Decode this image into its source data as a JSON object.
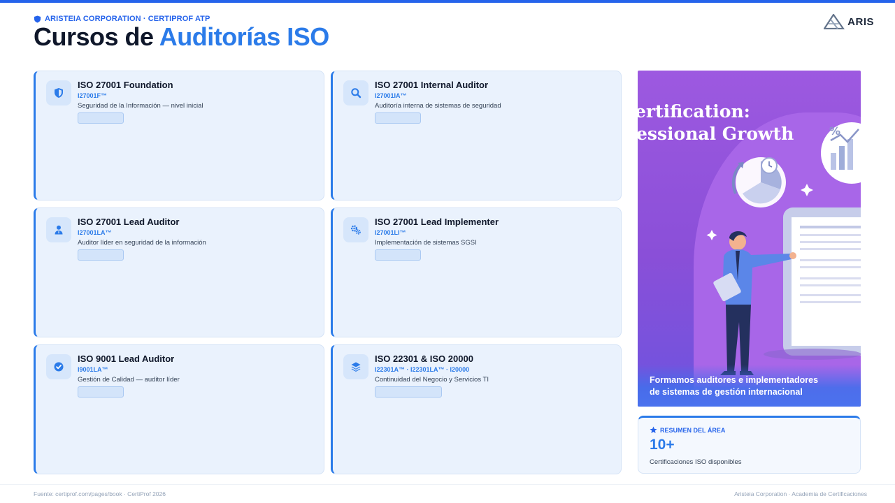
{
  "header": {
    "eyebrow": "ARISTEIA CORPORATION · CERTIPROF ATP",
    "title_prefix": "Cursos de ",
    "title_accent": "Auditorías ISO",
    "logo_text": "ARIS"
  },
  "courses": [
    {
      "icon": "shield-icon",
      "title": "ISO 27001 Foundation",
      "code": "I27001F™",
      "desc": "Seguridad de la Información — nivel inicial"
    },
    {
      "icon": "search-icon",
      "title": "ISO 27001 Internal Auditor",
      "code": "I27001IA™",
      "desc": "Auditoría interna de sistemas de seguridad"
    },
    {
      "icon": "user-tie-icon",
      "title": "ISO 27001 Lead Auditor",
      "code": "I27001LA™",
      "desc": "Auditor líder en seguridad de la información"
    },
    {
      "icon": "gears-icon",
      "title": "ISO 27001 Lead Implementer",
      "code": "I27001LI™",
      "desc": "Implementación de sistemas SGSI"
    },
    {
      "icon": "check-circle-icon",
      "title": "ISO 9001 Lead Auditor",
      "code": "I9001LA™",
      "desc": "Gestión de Calidad — auditor líder"
    },
    {
      "icon": "layers-icon",
      "title": "ISO 22301 & ISO 20000",
      "code": "I22301A™ · I22301LA™ · I20000",
      "desc": "Continuidad del Negocio y Servicios TI"
    }
  ],
  "hero": {
    "line1": "ertification:",
    "line2": "essional Growth",
    "caption_line1": "Formamos auditores e implementadores",
    "caption_line2": "de sistemas de gestión internacional"
  },
  "summary": {
    "label": "RESUMEN DEL ÁREA",
    "value": "10+",
    "desc": "Certificaciones ISO disponibles"
  },
  "footer": {
    "left": "Fuente: certiprof.com/pages/book · CertiProf 2026",
    "right": "Aristeia Corporation · Academia de Certificaciones"
  },
  "colors": {
    "accent": "#2b7be9",
    "card_bg": "#eaf2fd",
    "hero_purple": "#9d59e0"
  }
}
